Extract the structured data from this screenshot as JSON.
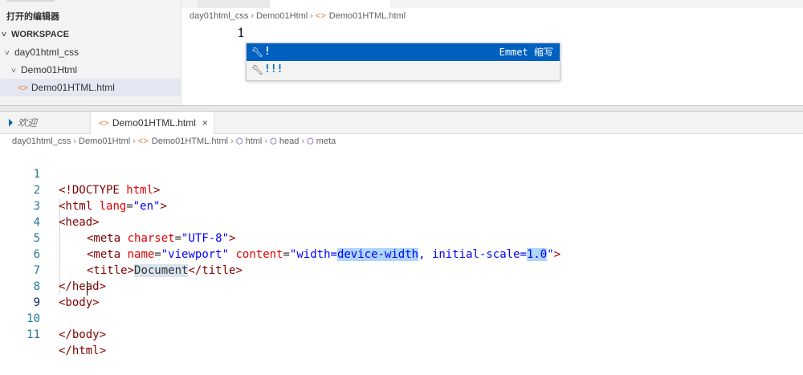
{
  "top": {
    "sidebar": {
      "open_editors_label": "打开的编辑器",
      "workspace_label": "WORKSPACE",
      "folder": "day01html_css",
      "subfolder": "Demo01Html",
      "file": "Demo01HTML.html"
    },
    "breadcrumb": [
      "day01html_css",
      "Demo01Html",
      "Demo01HTML.html"
    ],
    "line_number": "1",
    "typed_text": "!",
    "suggestions": [
      {
        "label": "!",
        "detail": "Emmet 缩写"
      },
      {
        "label": "!!!",
        "detail": ""
      }
    ]
  },
  "tabs": {
    "welcome": "欢迎",
    "file": "Demo01HTML.html",
    "close": "×"
  },
  "breadcrumb": [
    "day01html_css",
    "Demo01Html",
    "Demo01HTML.html",
    "html",
    "head",
    "meta"
  ],
  "code_lines": [
    {
      "n": "1"
    },
    {
      "n": "2"
    },
    {
      "n": "3"
    },
    {
      "n": "4"
    },
    {
      "n": "5"
    },
    {
      "n": "6"
    },
    {
      "n": "7"
    },
    {
      "n": "8"
    },
    {
      "n": "9"
    },
    {
      "n": "10"
    },
    {
      "n": "11"
    }
  ],
  "code": {
    "l1_tag": "<!DOCTYPE",
    "l1_attr": " html",
    "l1_end": ">",
    "l2_tag": "<html",
    "l2_attr": " lang",
    "l2_eq": "=",
    "l2_val": "\"en\"",
    "l2_end": ">",
    "l3": "<head>",
    "l4_tag": "<meta",
    "l4_attr": " charset",
    "l4_eq": "=",
    "l4_val": "\"UTF-8\"",
    "l4_end": ">",
    "l5_tag": "<meta",
    "l5_attr1": " name",
    "l5_eq1": "=",
    "l5_val1": "\"viewport\"",
    "l5_attr2": " content",
    "l5_eq2": "=",
    "l5_val2a": "\"width=",
    "l5_val2b": "device-width",
    "l5_val2c": ", initial-scale=",
    "l5_val2d": "1.0",
    "l5_val2e": "\"",
    "l5_end": ">",
    "l6_open": "<title>",
    "l6_text": "Document",
    "l6_close": "</title>",
    "l7": "</head>",
    "l8": "<body>",
    "l9": "",
    "l10": "</body>",
    "l11": "</html>"
  },
  "colors": {
    "tag": "#800000",
    "attribute": "#e50000",
    "value": "#0000ff",
    "selection": "#0060c0"
  }
}
